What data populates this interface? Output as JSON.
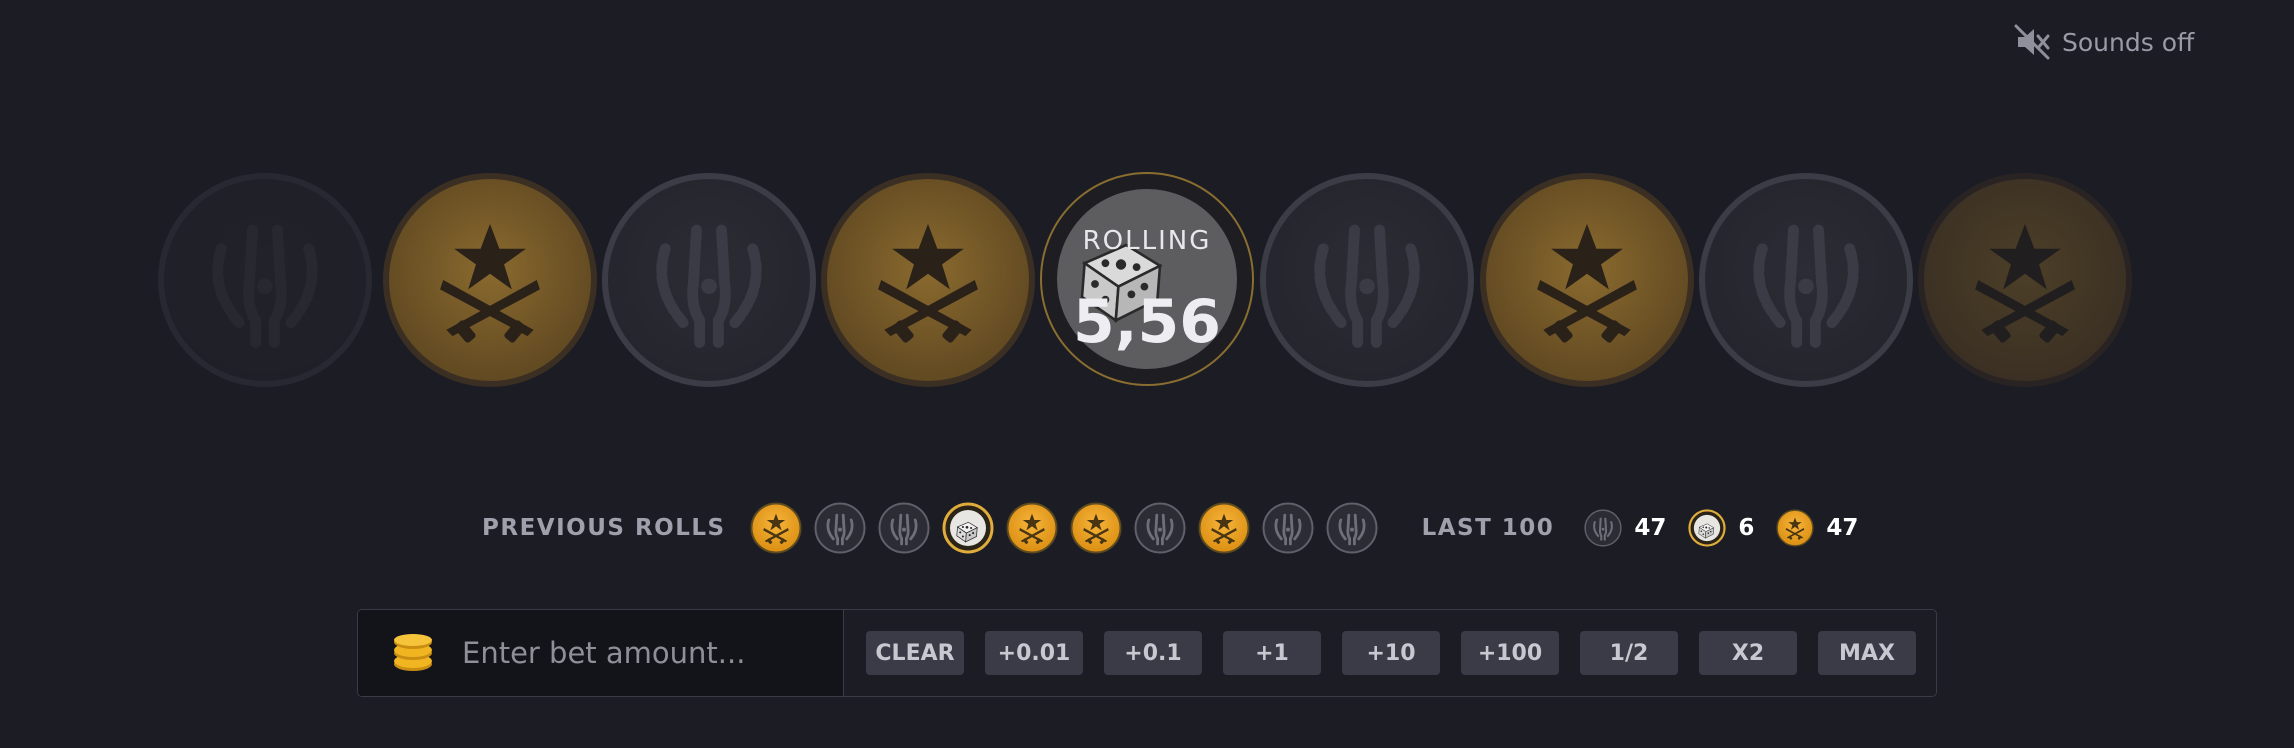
{
  "sound": {
    "label": "Sounds off",
    "icon": "speaker-muted-icon"
  },
  "roller": {
    "label": "ROLLING",
    "value": "5,56",
    "coins": [
      "ct",
      "t",
      "ct",
      "t",
      "center",
      "ct",
      "t",
      "ct",
      "t"
    ]
  },
  "previous_rolls": {
    "label": "PREVIOUS ROLLS",
    "items": [
      "t",
      "ct",
      "ct",
      "bonus",
      "t",
      "t",
      "ct",
      "t",
      "ct",
      "ct"
    ]
  },
  "last_100": {
    "label": "LAST 100",
    "stats": [
      {
        "type": "ct",
        "count": "47"
      },
      {
        "type": "bonus",
        "count": "6"
      },
      {
        "type": "t",
        "count": "47"
      }
    ]
  },
  "bet": {
    "placeholder": "Enter bet amount...",
    "icon": "coin-stack-icon",
    "buttons": [
      "CLEAR",
      "+0.01",
      "+0.1",
      "+1",
      "+10",
      "+100",
      "1/2",
      "X2",
      "MAX"
    ]
  },
  "colors": {
    "background": "#1b1c24",
    "t_gold": "#e8a321",
    "ct_grey": "#2f3038",
    "bonus_gold": "#d7a43a"
  }
}
